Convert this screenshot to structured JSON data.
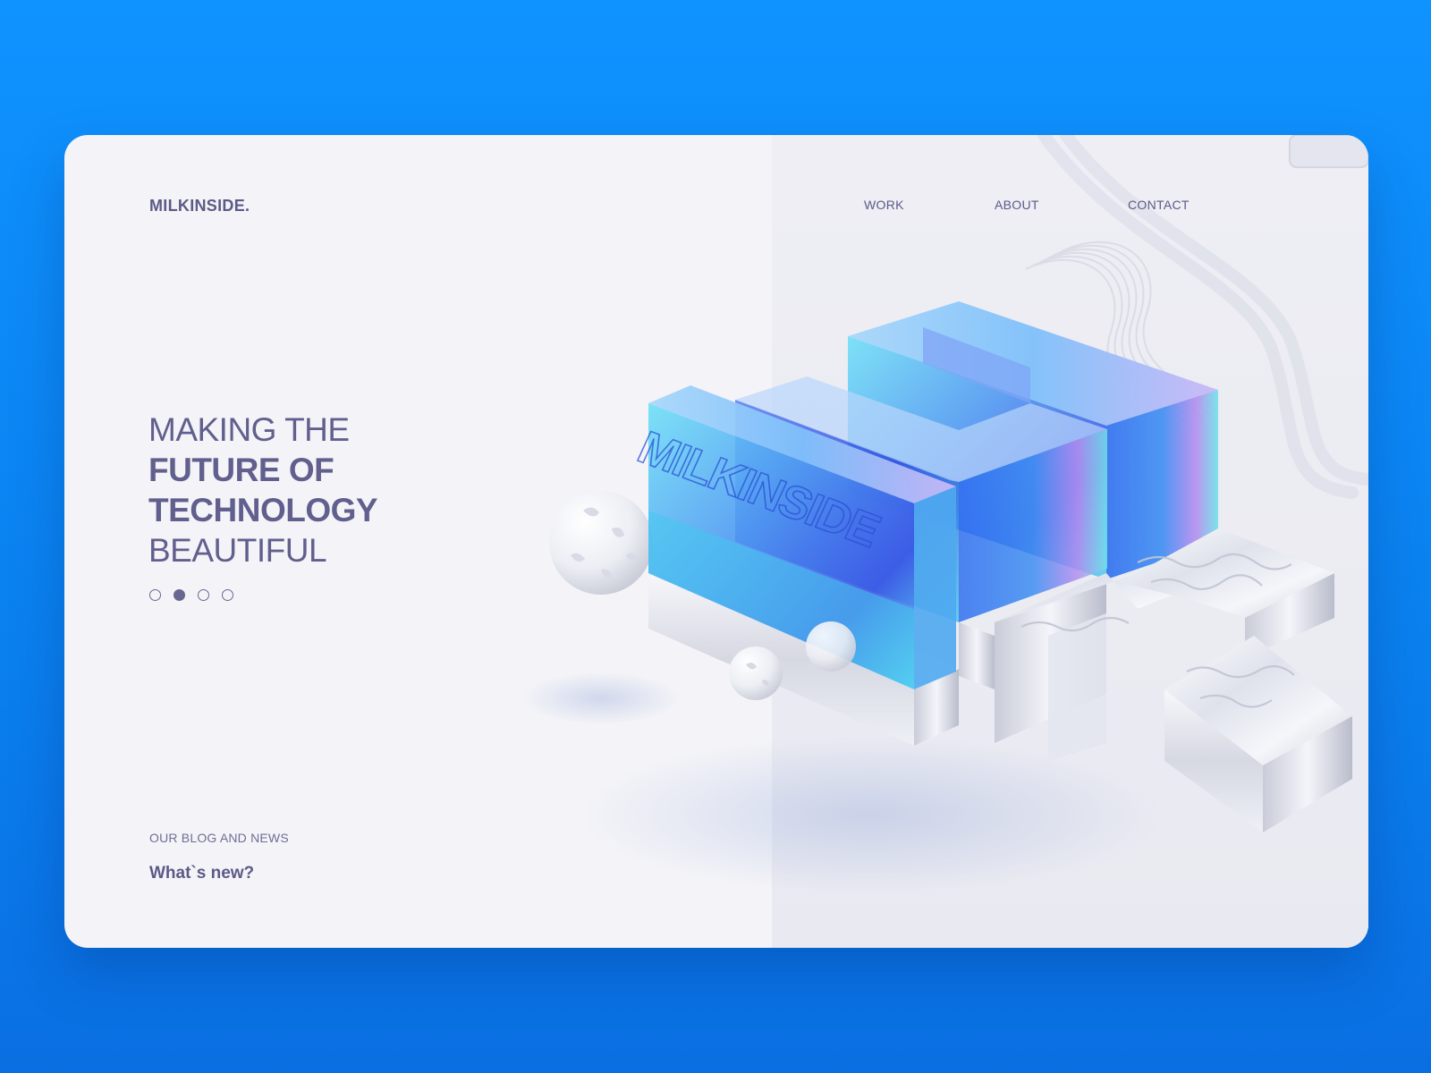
{
  "header": {
    "brand": "MILKINSIDE.",
    "nav": [
      {
        "label": "WORK"
      },
      {
        "label": "ABOUT"
      },
      {
        "label": "CONTACT"
      }
    ]
  },
  "hero": {
    "line1": "MAKING THE",
    "line2": "FUTURE OF",
    "line3": "TECHNOLOGY",
    "line4": "BEAUTIFUL",
    "slider": {
      "count": 4,
      "active_index": 2
    }
  },
  "scene": {
    "engraved_text": "MILKINSIDE"
  },
  "blog": {
    "label": "OUR BLOG AND NEWS",
    "link": "What`s new?"
  },
  "colors": {
    "background": "#0f93ff",
    "card": "#f4f4f8",
    "text": "#5c5a86",
    "glass_blue": "#3f7bf0",
    "glass_cyan": "#45c8f0"
  }
}
